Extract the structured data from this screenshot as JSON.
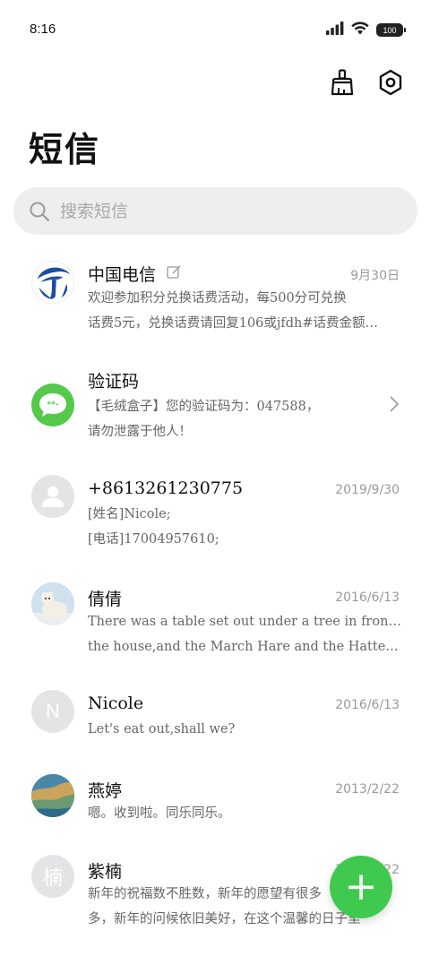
{
  "status_bar": {
    "time": "8:16",
    "battery": "100"
  },
  "header": {
    "title": "短信",
    "icons": [
      "broom-icon",
      "settings-hex-icon"
    ]
  },
  "search": {
    "placeholder": "搜索短信"
  },
  "messages": [
    {
      "name": "中国电信",
      "date": "9月30日",
      "line1": "欢迎参加积分兑换话费活动，每500分可兑换",
      "line2": "话费5元，兑换话费请回复106或jfdh#话费金额…",
      "avatar": "china-telecom-logo",
      "has_edit_icon": true
    },
    {
      "name": "验证码",
      "date": "",
      "line1": "【毛绒盒子】您的验证码为：047588，",
      "line2": "请勿泄露于他人！",
      "avatar": "message-bubble-icon"
    },
    {
      "name": "+8613261230775",
      "date": "2019/9/30",
      "line1": "[姓名]Nicole;",
      "line2": "[电话]17004957610;",
      "avatar": "person-icon"
    },
    {
      "name": "倩倩",
      "date": "2016/6/13",
      "line1": "There was a table set out under a tree in front of",
      "line2": "the house,and the March Hare and the Hatter were having tea",
      "avatar": "polar-bear-photo"
    },
    {
      "name": "Nicole",
      "date": "2016/6/13",
      "line1": "Let's eat out,shall we?",
      "line2": "",
      "avatar": "N"
    },
    {
      "name": "燕婷",
      "date": "2013/2/22",
      "line1": "嗯。收到啦。同乐同乐。",
      "line2": "",
      "avatar": "landscape-photo"
    },
    {
      "name": "紫楠",
      "date": "2013/2/22",
      "line1": "新年的祝福数不胜数，新年的愿望有很多",
      "line2": "多，新年的问候依旧美好，在这个温馨的日子里",
      "avatar": "楠"
    }
  ],
  "fab": {
    "label": "+"
  },
  "colors": {
    "accent_green": "#3fc94e",
    "telecom_blue": "#1a4fa0"
  }
}
